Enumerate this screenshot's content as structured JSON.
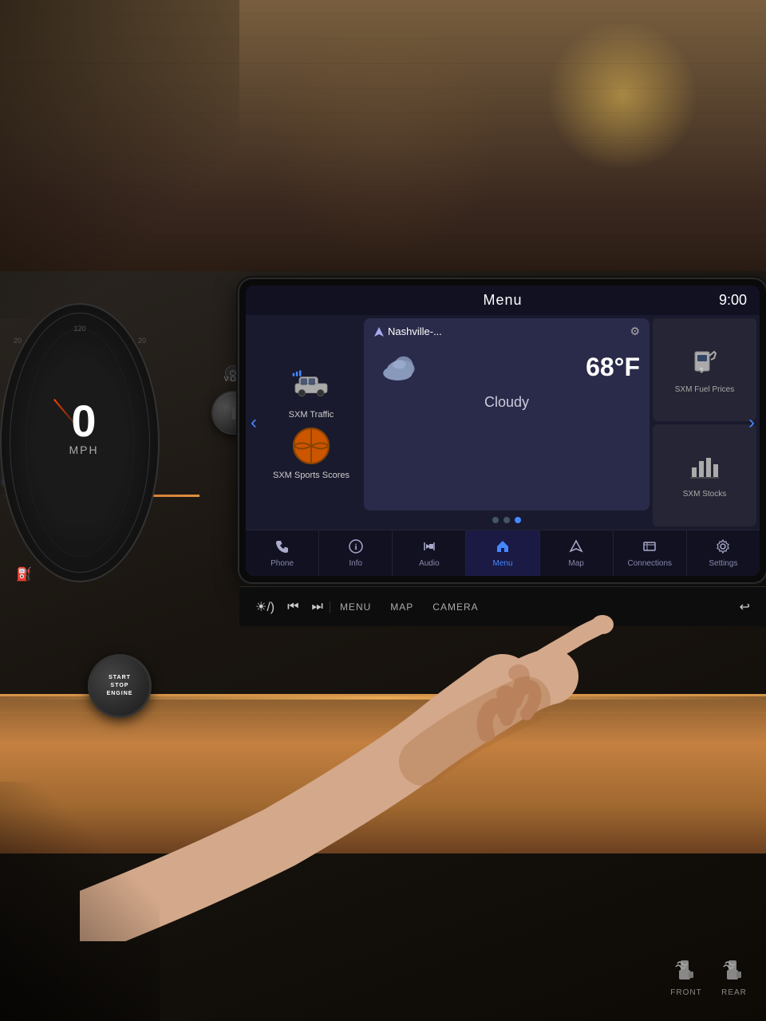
{
  "scene": {
    "background": "car interior with infotainment screen"
  },
  "screen": {
    "header": {
      "title": "Menu",
      "time": "9:00"
    },
    "carousel": {
      "left_arrow": "‹",
      "right_arrow": "›",
      "current_item": {
        "icon": "car",
        "label": "SXM Traffic"
      },
      "basketball_item": {
        "icon": "basketball",
        "label": "SXM Sports Scores"
      }
    },
    "weather": {
      "location": "Nashville-...",
      "temperature": "68°F",
      "condition": "Cloudy",
      "settings_icon": "⚙"
    },
    "right_cards": [
      {
        "icon": "fuel",
        "label": "SXM Fuel Prices"
      },
      {
        "icon": "stocks",
        "label": "SXM Stocks"
      }
    ],
    "dots": [
      {
        "active": false
      },
      {
        "active": false
      },
      {
        "active": true
      }
    ],
    "nav": [
      {
        "icon": "📞",
        "label": "Phone",
        "active": false
      },
      {
        "icon": "ℹ",
        "label": "Info",
        "active": false
      },
      {
        "icon": "♪",
        "label": "Audio",
        "active": false
      },
      {
        "icon": "⌂",
        "label": "Menu",
        "active": true
      },
      {
        "icon": "△",
        "label": "Map",
        "active": false
      },
      {
        "icon": "◫",
        "label": "Connections",
        "active": false
      },
      {
        "icon": "⚙",
        "label": "Settings",
        "active": false
      }
    ]
  },
  "controls": {
    "vol_label": "VOL",
    "power_icon": "⏻",
    "control_bar": [
      {
        "icon": "☀",
        "label": ""
      },
      {
        "icon": "⏮",
        "label": ""
      },
      {
        "icon": "⏭",
        "label": ""
      },
      {
        "label": "MENU"
      },
      {
        "label": "MAP"
      },
      {
        "label": "CAMERA"
      },
      {
        "icon": "↩",
        "label": ""
      }
    ]
  },
  "speedometer": {
    "speed": "0",
    "unit": "MPH"
  },
  "start_stop": {
    "line1": "START",
    "line2": "STOP",
    "line3": "ENGINE"
  },
  "bottom_controls": [
    {
      "label": "FRONT"
    },
    {
      "label": "REAR"
    }
  ]
}
